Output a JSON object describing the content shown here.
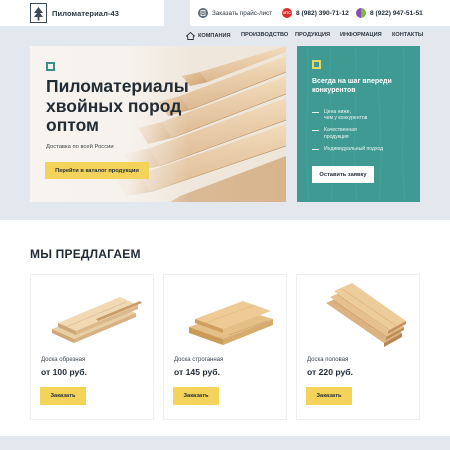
{
  "header": {
    "brand": "Пиломатериал-43",
    "price_list": "Заказать прайс-лист",
    "phone_mts": "8 (982) 390-71-12",
    "phone_mega": "8 (922) 947-51-51",
    "mts_badge": "МТС"
  },
  "nav": {
    "items": [
      "КОМПАНИЯ",
      "ПРОИЗВОДСТВО",
      "ПРОДУКЦИЯ",
      "ИНФОРМАЦИЯ",
      "КОНТАКТЫ"
    ]
  },
  "hero": {
    "title": "Пиломатериалы хвойных пород оптом",
    "subtitle": "Доставка по всей России",
    "button": "Перейти в каталог продукции"
  },
  "side": {
    "title": "Всегда на шаг впереди конкурентов",
    "items": [
      "Цена ниже,\nчем у конкурентов",
      "Качественная\nпродукция",
      "Индивидуальный подход"
    ],
    "button": "Оставить заявку"
  },
  "offer": {
    "title": "МЫ ПРЕДЛАГАЕМ",
    "cards": [
      {
        "name": "Доска обрезная",
        "price": "от 100 руб.",
        "button": "Заказать"
      },
      {
        "name": "Доска строганная",
        "price": "от 145 руб.",
        "button": "Заказать"
      },
      {
        "name": "Доска половая",
        "price": "от 220 руб.",
        "button": "Заказать"
      }
    ]
  },
  "colors": {
    "accent_yellow": "#f4d35b",
    "teal_panel": "#3f9a93",
    "page_bg": "#e3e8ee",
    "text_dark": "#1f2a36"
  },
  "icons": {
    "logo": "tree-logo-icon",
    "price_list": "document-icon",
    "mts": "mts-logo-icon",
    "megafon": "megafon-logo-icon",
    "home": "home-icon"
  }
}
